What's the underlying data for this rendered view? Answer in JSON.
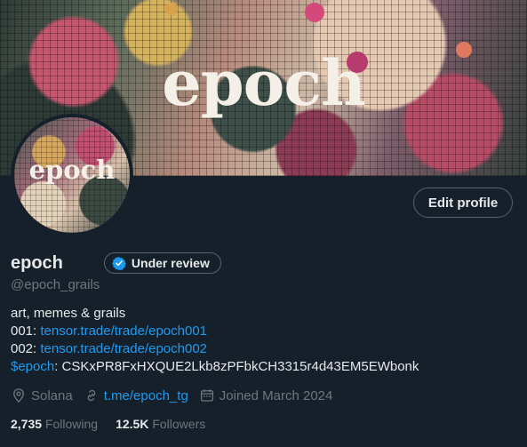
{
  "banner": {
    "title": "epoch"
  },
  "avatar": {
    "title": "epoch"
  },
  "profile": {
    "edit_label": "Edit profile",
    "display_name": "epoch",
    "badge_label": "Under review",
    "handle": "@epoch_grails"
  },
  "bio": {
    "line1": "art, memes & grails",
    "line2_prefix": "001: ",
    "line2_link": "tensor.trade/trade/epoch001",
    "line3_prefix": "002: ",
    "line3_link": "tensor.trade/trade/epoch002",
    "line4_cashtag": "$epoch",
    "line4_rest": ": CSKxPR8FxHXQUE2Lkb8zPFbkCH3315r4d43EM5EWbonk"
  },
  "meta": {
    "location": "Solana",
    "website": "t.me/epoch_tg",
    "joined": "Joined March 2024"
  },
  "counts": {
    "following_value": "2,735",
    "following_label": "Following",
    "followers_value": "12.5K",
    "followers_label": "Followers"
  },
  "colors": {
    "background": "#15202b",
    "link": "#1d9bf0",
    "muted": "#71767b"
  }
}
